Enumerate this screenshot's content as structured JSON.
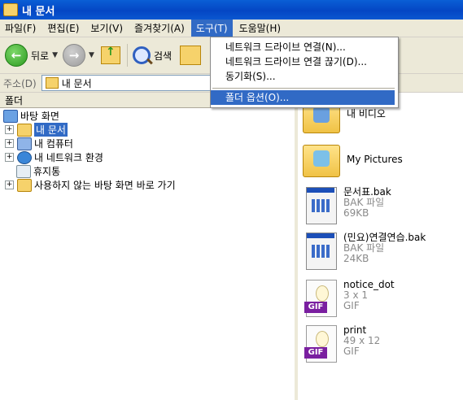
{
  "window": {
    "title": "내 문서"
  },
  "menubar": {
    "items": [
      "파일(F)",
      "편집(E)",
      "보기(V)",
      "즐겨찾기(A)",
      "도구(T)",
      "도움말(H)"
    ],
    "active_index": 4
  },
  "toolbar": {
    "back_label": "뒤로",
    "search_label": "검색"
  },
  "address": {
    "label": "주소(D)",
    "value": "내 문서"
  },
  "folders_pane": {
    "header": "폴더"
  },
  "tree": {
    "items": [
      {
        "label": "바탕 화면"
      },
      {
        "label": "내 문서"
      },
      {
        "label": "내 컴퓨터"
      },
      {
        "label": "내 네트워크 환경"
      },
      {
        "label": "휴지통"
      },
      {
        "label": "사용하지 않는 바탕 화면 바로 가기"
      }
    ]
  },
  "files": [
    {
      "name": "내 비디오"
    },
    {
      "name": "My Pictures"
    },
    {
      "name": "문서표.bak",
      "type": "BAK 파일",
      "size": "69KB"
    },
    {
      "name": "(민요)연결연습.bak",
      "type": "BAK 파일",
      "size": "24KB"
    },
    {
      "name": "notice_dot",
      "dims": "3 x 1",
      "type": "GIF"
    },
    {
      "name": "print",
      "dims": "49 x 12",
      "type": "GIF"
    }
  ],
  "tools_menu": {
    "items": [
      "네트워크 드라이브 연결(N)...",
      "네트워크 드라이브 연결 끊기(D)...",
      "동기화(S)...",
      "폴더 옵션(O)..."
    ],
    "highlighted_index": 3
  },
  "colors": {
    "title_bar": "#0a5fd6",
    "selection": "#316ac5",
    "chrome": "#ece9d8"
  },
  "icons": {
    "back": "back-arrow-icon",
    "forward": "forward-arrow-icon",
    "up": "up-folder-icon",
    "search": "magnifier-icon",
    "folders": "folders-icon"
  }
}
